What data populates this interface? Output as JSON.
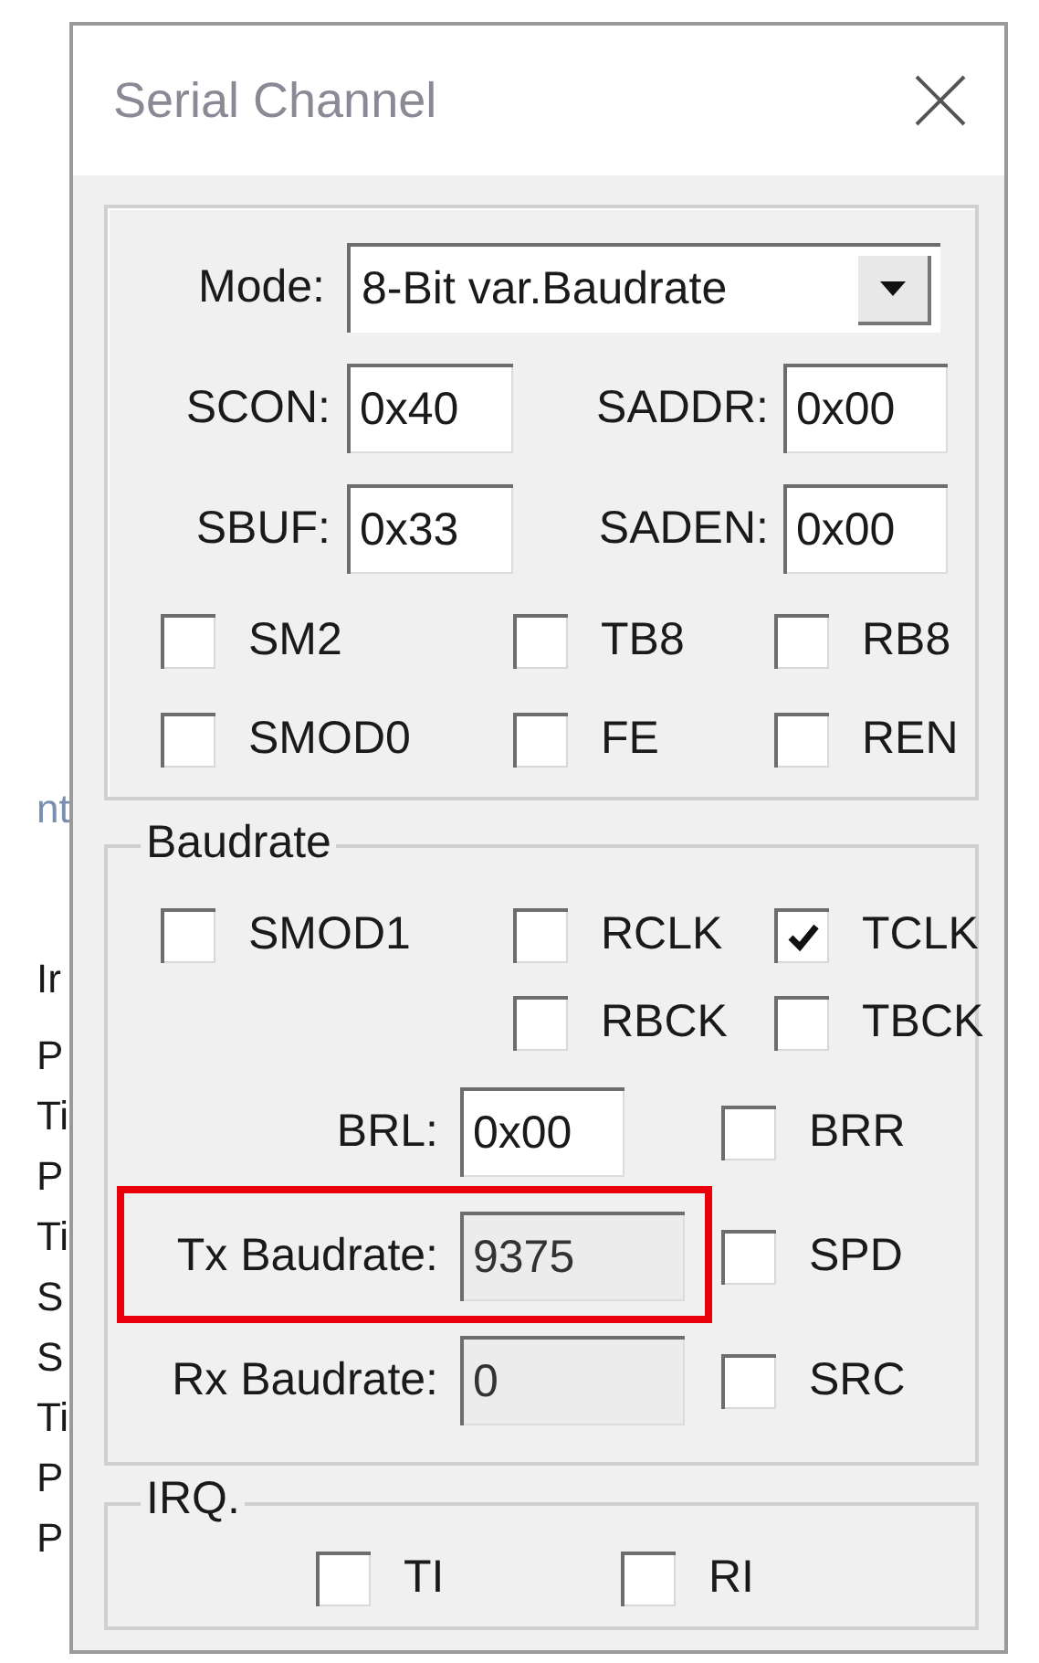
{
  "background_window": {
    "fragments": [
      "nt",
      "Ir",
      "P",
      "Ti",
      "P",
      "Ti",
      "S",
      "S",
      "Ti",
      "P",
      "P"
    ]
  },
  "dialog": {
    "title": "Serial Channel",
    "mode": {
      "label": "Mode:",
      "value": "8-Bit var.Baudrate"
    },
    "registers": [
      {
        "label": "SCON:",
        "value": "0x40"
      },
      {
        "label": "SADDR:",
        "value": "0x00"
      },
      {
        "label": "SBUF:",
        "value": "0x33"
      },
      {
        "label": "SADEN:",
        "value": "0x00"
      }
    ],
    "flags": [
      {
        "label": "SM2",
        "checked": false
      },
      {
        "label": "TB8",
        "checked": false
      },
      {
        "label": "RB8",
        "checked": false
      },
      {
        "label": "SMOD0",
        "checked": false
      },
      {
        "label": "FE",
        "checked": false
      },
      {
        "label": "REN",
        "checked": false
      }
    ],
    "baudrate": {
      "title": "Baudrate",
      "flags": [
        {
          "label": "SMOD1",
          "checked": false
        },
        {
          "label": "RCLK",
          "checked": false
        },
        {
          "label": "TCLK",
          "checked": true
        },
        {
          "label": "RBCK",
          "checked": false
        },
        {
          "label": "TBCK",
          "checked": false
        }
      ],
      "brl": {
        "label": "BRL:",
        "value": "0x00"
      },
      "rates": [
        {
          "label": "Tx Baudrate:",
          "value": "9375",
          "read_only": true,
          "highlighted": true
        },
        {
          "label": "Rx Baudrate:",
          "value": "0",
          "read_only": true,
          "highlighted": false
        }
      ],
      "side_flags": [
        {
          "label": "BRR",
          "checked": false
        },
        {
          "label": "SPD",
          "checked": false
        },
        {
          "label": "SRC",
          "checked": false
        }
      ]
    },
    "irq": {
      "title": "IRQ.",
      "flags": [
        {
          "label": "TI",
          "checked": false
        },
        {
          "label": "RI",
          "checked": false
        }
      ]
    }
  }
}
